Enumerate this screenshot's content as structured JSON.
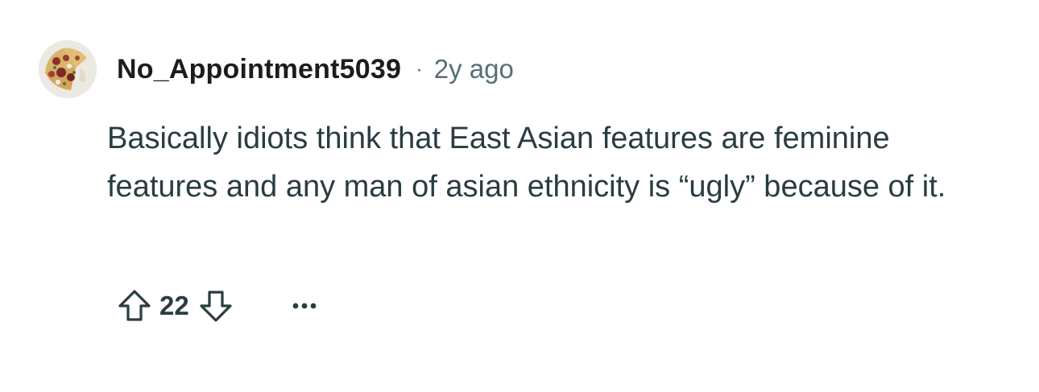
{
  "comment": {
    "author": "No_Appointment5039",
    "separator": "·",
    "age": "2y ago",
    "text": "Basically idiots think that East Asian features are feminine features and any man of asian ethnicity is “ugly” because of it.",
    "score": "22",
    "avatar_icon": "pizza-avatar-icon",
    "upvote_icon": "upvote-arrow-icon",
    "downvote_icon": "downvote-arrow-icon",
    "more_icon": "ellipsis-icon"
  },
  "colors": {
    "text": "#2a3c42",
    "username": "#1c1c1c",
    "meta": "#576f76",
    "background": "#ffffff"
  }
}
